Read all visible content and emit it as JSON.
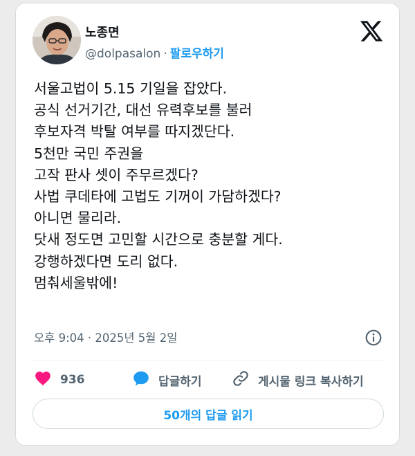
{
  "tweet": {
    "author_name": "노종면",
    "handle": "@dolpasalon",
    "separator": "·",
    "follow_label": "팔로우하기",
    "body_lines": [
      "서울고법이 5.15 기일을 잡았다.",
      "공식 선거기간, 대선 유력후보를 불러",
      "후보자격 박탈 여부를 따지겠단다.",
      "5천만 국민 주권을",
      "고작 판사 셋이 주무르겠다?",
      "사법 쿠데타에 고법도 기꺼이 가담하겠다?",
      "아니면 물리라.",
      "닷새 정도면 고민할 시간으로 충분할 게다.",
      "강행하겠다면 도리 없다.",
      "멈춰세울밖에!"
    ],
    "timestamp": "오후 9:04 · 2025년 5월 2일"
  },
  "actions": {
    "like_count": "936",
    "reply_label": "답글하기",
    "copy_link_label": "게시물 링크 복사하기"
  },
  "read_replies_label": "50개의 답글 읽기",
  "icons": {
    "brand": "x-logo-icon",
    "info": "info-icon",
    "like": "heart-icon",
    "reply": "speech-bubble-icon",
    "link": "link-icon"
  },
  "colors": {
    "accent": "#1d9bf0",
    "like": "#f91880",
    "text": "#0f1419",
    "secondary": "#536471"
  }
}
